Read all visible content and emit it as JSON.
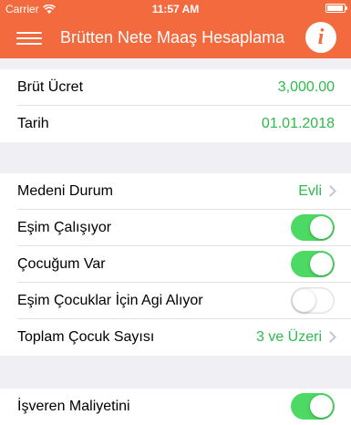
{
  "status": {
    "carrier": "Carrier",
    "time": "11:57 AM"
  },
  "navbar": {
    "title": "Brütten Nete Maaş Hesaplama",
    "info_glyph": "i"
  },
  "section1": {
    "gross": {
      "label": "Brüt Ücret",
      "value": "3,000.00"
    },
    "date": {
      "label": "Tarih",
      "value": "01.01.2018"
    }
  },
  "section2": {
    "marital": {
      "label": "Medeni Durum",
      "value": "Evli"
    },
    "spouse_working": {
      "label": "Eşim Çalışıyor",
      "on": true
    },
    "child": {
      "label": "Çocuğum Var",
      "on": true
    },
    "spouse_agi": {
      "label": "Eşim Çocuklar İçin Agi Alıyor",
      "on": false
    },
    "child_count": {
      "label": "Toplam Çocuk Sayısı",
      "value": "3 ve Üzeri"
    }
  },
  "section3": {
    "employer_cost": {
      "label": "İşveren Maliyetini",
      "on": true
    }
  },
  "colors": {
    "brand": "#f26a3d",
    "value": "#2dbb4b",
    "switch_on": "#4cd964"
  }
}
